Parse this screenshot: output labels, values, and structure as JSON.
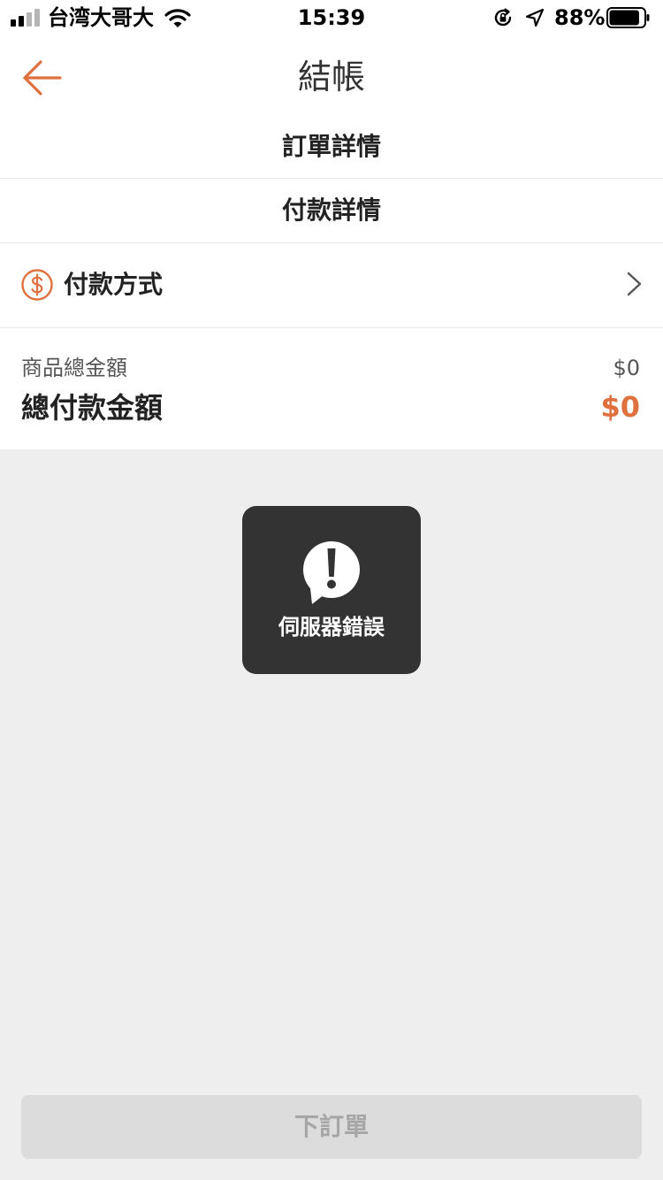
{
  "status_bar": {
    "carrier": "台湾大哥大",
    "time": "15:39",
    "battery_percent": "88%",
    "battery_level": 0.88,
    "icons": [
      "signal-icon",
      "wifi-icon",
      "rotation-lock-icon",
      "location-icon",
      "battery-icon"
    ]
  },
  "nav": {
    "title": "結帳",
    "back_icon": "arrow-left-icon"
  },
  "sections": {
    "order_details": "訂單詳情",
    "payment_details": "付款詳情"
  },
  "payment_method": {
    "label": "付款方式",
    "icon": "dollar-circle-icon",
    "chevron_icon": "chevron-right-icon"
  },
  "totals": {
    "subtotal_label": "商品總金額",
    "subtotal_value": "$0",
    "total_label": "總付款金額",
    "total_value": "$0"
  },
  "toast": {
    "message": "伺服器錯誤",
    "icon": "exclamation-bubble-icon"
  },
  "submit": {
    "label": "下訂單"
  },
  "colors": {
    "accent": "#E0703E",
    "background": "#EEEEEE",
    "surface": "#FFFFFF",
    "toast_bg": "#333333",
    "button_disabled_bg": "#DCDCDC",
    "button_disabled_text": "#A6A6A6"
  }
}
